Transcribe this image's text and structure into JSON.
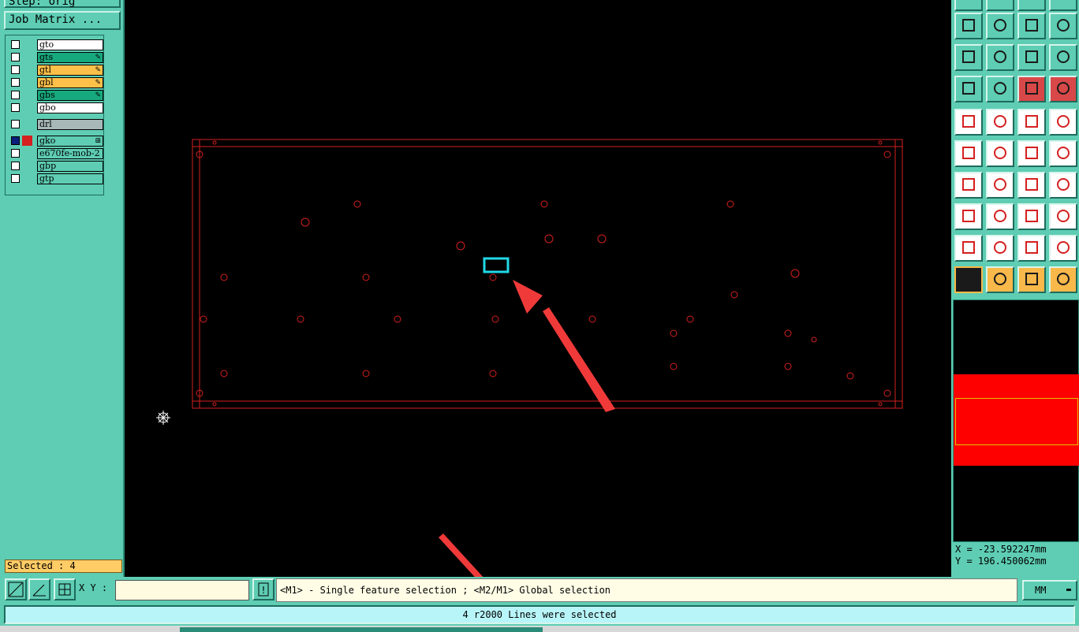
{
  "left_panel": {
    "step_label": "Step: orig",
    "job_matrix_label": "Job Matrix ...",
    "layers": [
      {
        "name": "gto",
        "color": "#ffffff",
        "mark": ""
      },
      {
        "name": "gts",
        "color": "#17a97e",
        "mark": "✎"
      },
      {
        "name": "gtl",
        "color": "#ffc04a",
        "mark": "✎"
      },
      {
        "name": "gbl",
        "color": "#ffc04a",
        "mark": "✎"
      },
      {
        "name": "gbs",
        "color": "#17a97e",
        "mark": "✎"
      },
      {
        "name": "gbo",
        "color": "#ffffff",
        "mark": ""
      },
      {
        "name": "drl",
        "color": "#a8b8b8",
        "mark": ""
      },
      {
        "name": "gko",
        "color": "#5ecdb3",
        "mark": "⊞"
      },
      {
        "name": "e670fe-mob-2",
        "color": "#5ecdb3",
        "mark": ""
      },
      {
        "name": "gbp",
        "color": "#5ecdb3",
        "mark": ""
      },
      {
        "name": "gtp",
        "color": "#5ecdb3",
        "mark": ""
      }
    ],
    "selected_text": "Selected : 4"
  },
  "right_panel": {
    "coord_x": "X = -23.592247mm",
    "coord_y": "Y = 196.450062mm"
  },
  "command_bar": {
    "xy_label": "X Y :",
    "xy_value": "",
    "message": "<M1> - Single feature selection ; <M2/M1> Global selection",
    "units": "MM"
  },
  "status": {
    "text": "4 r2000 Lines were selected"
  },
  "colors": {
    "board_outline": "#d42020",
    "selection": "#20d8e8",
    "annotation_arrow": "#f03a3a",
    "panel_bg": "#5ecdb3"
  }
}
